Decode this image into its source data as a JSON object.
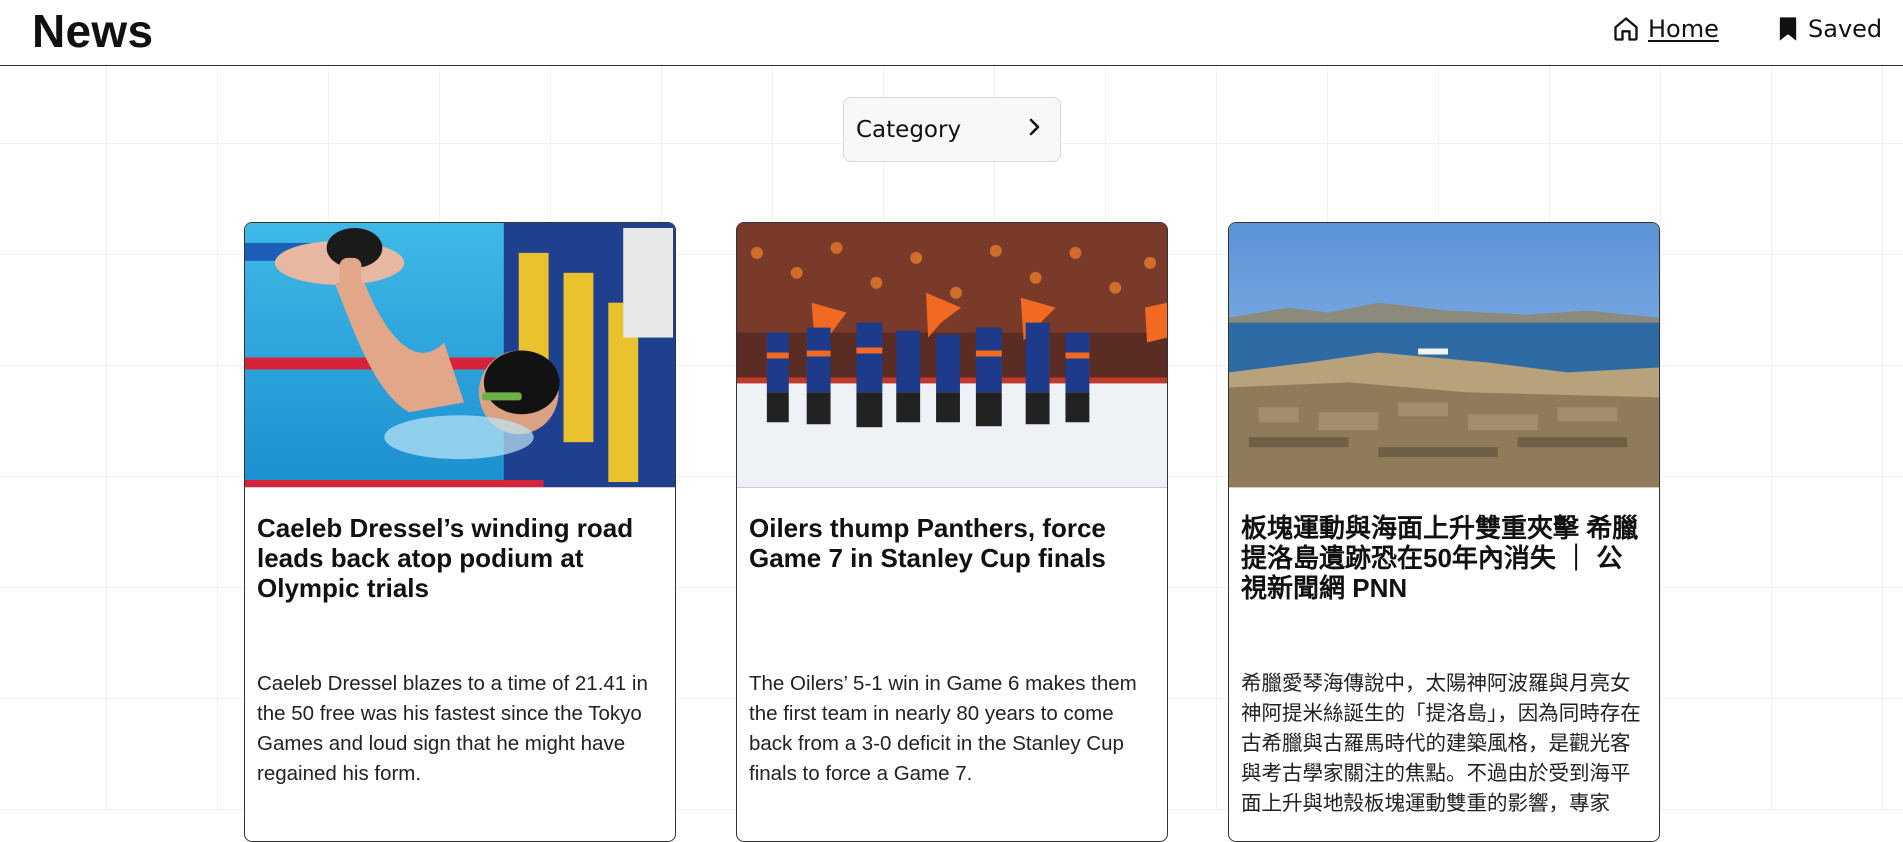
{
  "header": {
    "brand": "News",
    "nav": {
      "home_label": "Home",
      "home_icon": "home-icon",
      "saved_label": "Saved",
      "saved_icon": "bookmark-icon"
    }
  },
  "filter": {
    "category_label": "Category",
    "category_icon": "chevron-right-icon"
  },
  "articles": [
    {
      "title": "Caeleb Dressel’s winding road leads back atop podium at Olympic trials",
      "description": "Caeleb Dressel blazes to a time of 21.41 in the 50 free was his fastest since the Tokyo Games and loud sign that he might have regained his form.",
      "image": "swimmer-celebrating-in-pool"
    },
    {
      "title": "Oilers thump Panthers, force Game 7 in Stanley Cup finals",
      "description": "The Oilers’ 5-1 win in Game 6 makes them the first team in nearly 80 years to come back from a 3-0 deficit in the Stanley Cup finals to force a Game 7.",
      "image": "hockey-team-celebrating-on-ice"
    },
    {
      "title": "板塊運動與海面上升雙重夾擊 希臘提洛島遺跡恐在50年內消失 ｜ 公視新聞網 PNN",
      "description": "希臘愛琴海傳說中，太陽神阿波羅與月亮女神阿提米絲誕生的「提洛島」，因為同時存在古希臘與古羅馬時代的建築風格，是觀光客與考古學家關注的焦點。不過由於受到海平面上升與地殼板塊運動雙重的影響，專家",
      "image": "delos-island-ruins-by-sea"
    }
  ],
  "colors": {
    "grid": "#f1f1f1",
    "border": "#333333",
    "button_bg": "#f7f8fa"
  }
}
